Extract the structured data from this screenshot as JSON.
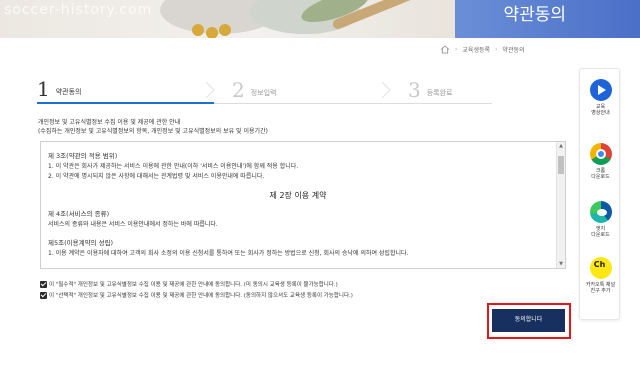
{
  "header": {
    "watermark": "soccer-history.com",
    "title": "약관동의"
  },
  "breadcrumb": {
    "home_icon": "home-icon",
    "items": [
      "교육생등록",
      "약관동의"
    ]
  },
  "steps": [
    {
      "num": "1",
      "label": "약관동의",
      "active": true
    },
    {
      "num": "2",
      "label": "정보입력",
      "active": false
    },
    {
      "num": "3",
      "label": "등록완료",
      "active": false
    }
  ],
  "intro": {
    "line1": "개인정보 및 고유식별정보 수집 이용 및 제공에 관한 안내",
    "line2": "(수집하는 개인정보 및 고유식별정보의 항목, 개인정보 및 고유식별정보의 보유 및 이용기간)"
  },
  "terms": {
    "art3_title": "제 3조(약관의 적용 범위)",
    "art3_1": "1. 이 약관은 회사가 제공하는 서비스 이용에 관한 안내(이하 '서비스 이용안내')에 함께 적용 합니다.",
    "art3_2": "2. 이 약관에 명시되지 않은 사항에 대해서는 관계법령 및 서비스 이용안내에 따릅니다.",
    "chapter": "제 2장 이용 계약",
    "art4_title": "제 4조(서비스의 종류)",
    "art4_1": "서비스의 종류와 내용은 서비스 이용안내에서 정하는 바에 따릅니다.",
    "art5_title": "제5조(이용계약의 성립)",
    "art5_1": "1. 이용 계약은 이용자에 대하여 고객의 회사 소정의 이용 신청서를 통하여 또는 회사가 정하는 방법으로 신청, 회사의 승낙에 의하여 성립합니다."
  },
  "checks": [
    {
      "text": "이 \"필수적\" 개인정보 및 고유식별정보 수집 이용 및 제공에 관한 안내에 동의합니다. (미 동의시 교육생 등록이 불가능합니다.)"
    },
    {
      "text": "이 \"선택적\" 개인정보 및 고유식별정보 수집 이용 및 제공에 관한 안내에 동의합니다. (동의하지 않으셔도 교육생 등록이 가능합니다.)"
    }
  ],
  "agree_button": "동의합니다",
  "sidebar": [
    {
      "icon": "play-icon",
      "label1": "교육",
      "label2": "영상안내"
    },
    {
      "icon": "chrome-icon",
      "label1": "크롬",
      "label2": "다운로드"
    },
    {
      "icon": "edge-icon",
      "label1": "엣지",
      "label2": "다운로드"
    },
    {
      "icon": "kakao-channel-icon",
      "badge": "Ch",
      "label1": "카카오톡 채널",
      "label2": "친구 추가"
    }
  ],
  "colors": {
    "step_active": "#1e6fd0",
    "button": "#18305f",
    "highlight": "#e8141b"
  }
}
